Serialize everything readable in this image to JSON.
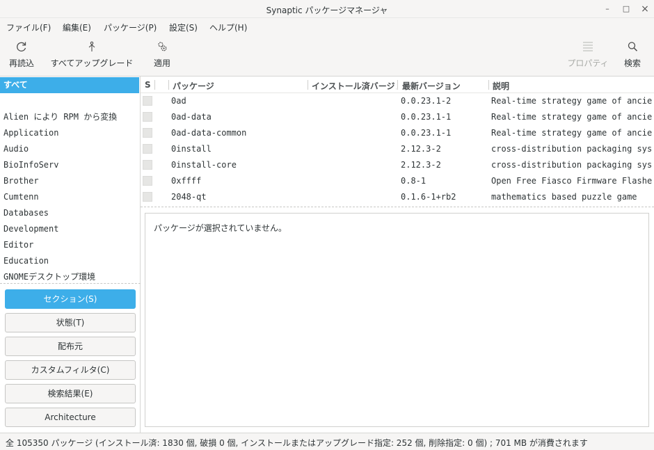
{
  "window": {
    "title": "Synaptic パッケージマネージャ",
    "minimize": "–",
    "maximize": "□",
    "close": "×"
  },
  "menubar": [
    "ファイル(F)",
    "編集(E)",
    "パッケージ(P)",
    "設定(S)",
    "ヘルプ(H)"
  ],
  "toolbar": {
    "reload": {
      "label": "再読込",
      "icon": "reload-icon"
    },
    "upgrade_all": {
      "label": "すべてアップグレード",
      "icon": "upgrade-icon"
    },
    "apply": {
      "label": "適用",
      "icon": "apply-gears-icon"
    },
    "properties": {
      "label": "プロパティ",
      "icon": "properties-icon",
      "enabled": false
    },
    "search": {
      "label": "検索",
      "icon": "search-icon"
    }
  },
  "sidebar": {
    "sections": [
      "すべて",
      "",
      "Alien により RPM から変換",
      "Application",
      "Audio",
      "BioInfoServ",
      "Brother",
      "Cumtenn",
      "Databases",
      "Development",
      "Editor",
      "Education",
      "GNOMEデスクトップ環境"
    ],
    "selected_index": 0,
    "filter_buttons": [
      "セクション(S)",
      "状態(T)",
      "配布元",
      "カスタムフィルタ(C)",
      "検索結果(E)",
      "Architecture"
    ],
    "active_filter_index": 0
  },
  "package_table": {
    "headers": {
      "status": "S",
      "package": "パッケージ",
      "installed_version": "インストール済バージョン",
      "latest_version": "最新バージョン",
      "description": "説明"
    },
    "rows": [
      {
        "package": "0ad",
        "installed": "",
        "latest": "0.0.23.1-2",
        "description": "Real-time strategy game of ancient warfare"
      },
      {
        "package": "0ad-data",
        "installed": "",
        "latest": "0.0.23.1-1",
        "description": "Real-time strategy game of ancient warfare"
      },
      {
        "package": "0ad-data-common",
        "installed": "",
        "latest": "0.0.23.1-1",
        "description": "Real-time strategy game of ancient warfare"
      },
      {
        "package": "0install",
        "installed": "",
        "latest": "2.12.3-2",
        "description": "cross-distribution packaging system"
      },
      {
        "package": "0install-core",
        "installed": "",
        "latest": "2.12.3-2",
        "description": "cross-distribution packaging system (non-GUI parts)"
      },
      {
        "package": "0xffff",
        "installed": "",
        "latest": "0.8-1",
        "description": "Open Free Fiasco Firmware Flasher"
      },
      {
        "package": "2048-qt",
        "installed": "",
        "latest": "0.1.6-1+rb2",
        "description": "mathematics based puzzle game"
      }
    ]
  },
  "details": {
    "message": "パッケージが選択されていません。"
  },
  "statusbar": {
    "text": "全 105350 パッケージ (インストール済: 1830 個, 破損 0 個, インストールまたはアップグレード指定: 252 個, 削除指定: 0 個) ; 701 MB が消費されます"
  },
  "colors": {
    "accent": "#3daee9",
    "window_bg": "#f6f5f4",
    "disabled_text": "#a8aaa6"
  }
}
